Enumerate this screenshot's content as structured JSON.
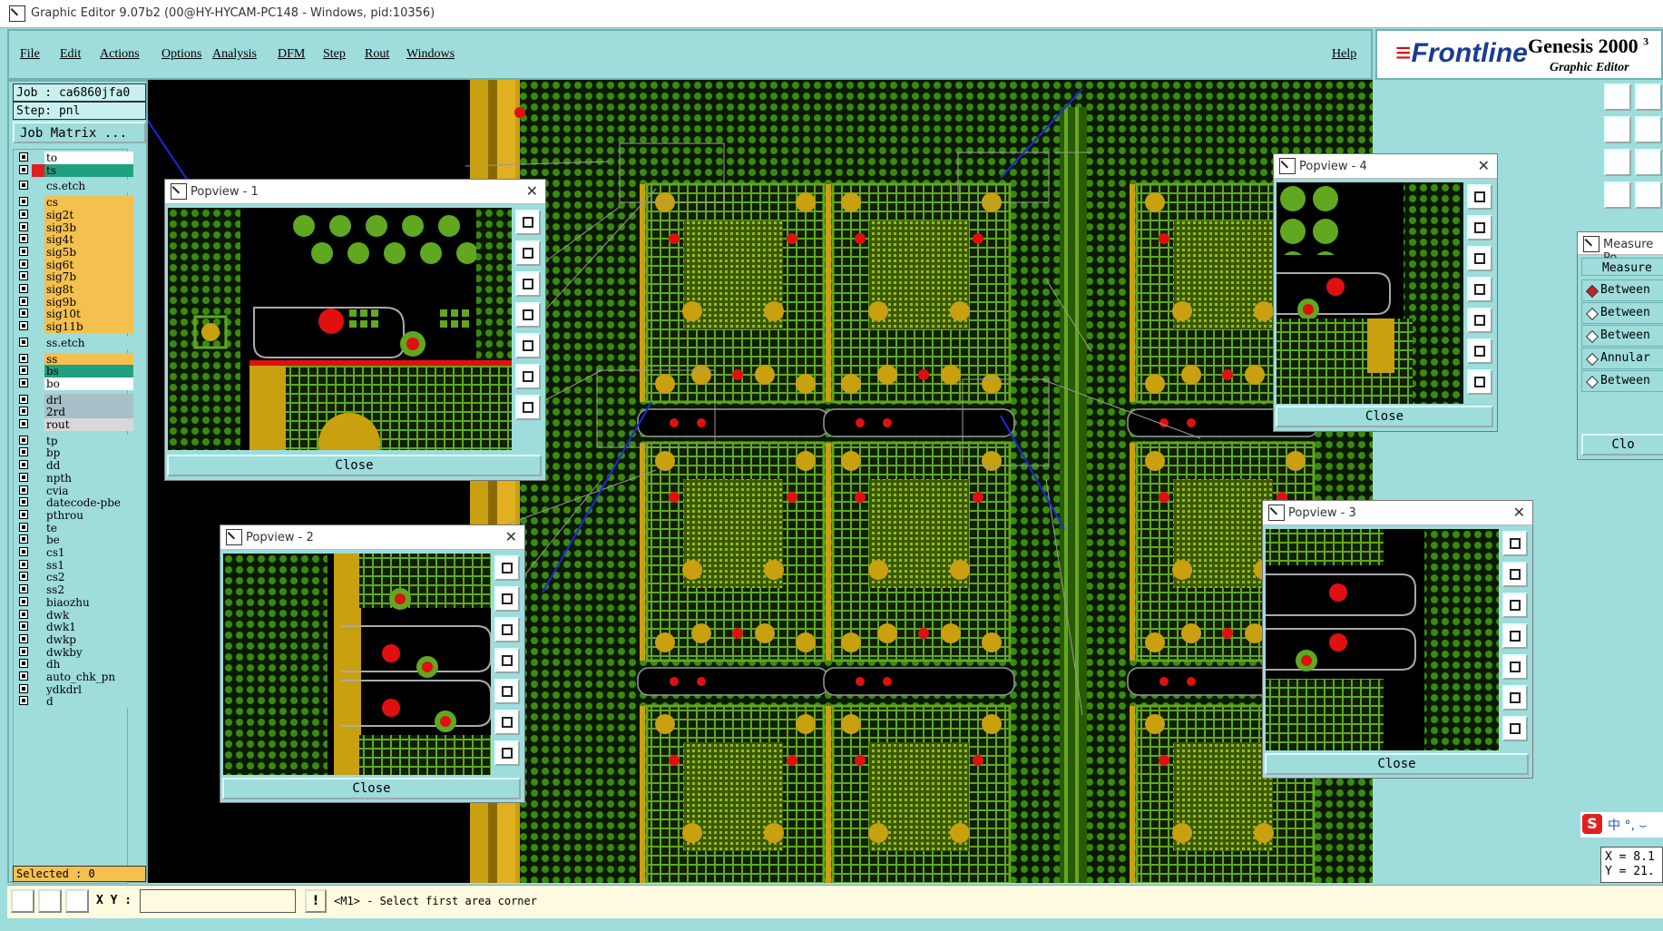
{
  "window": {
    "title": "Graphic Editor 9.07b2 (00@HY-HYCAM-PC148 - Windows, pid:10356)"
  },
  "menu": [
    "File",
    "Edit",
    "Actions",
    "Options",
    "Analysis",
    "DFM",
    "Step",
    "Rout",
    "Windows"
  ],
  "help": "Help",
  "brand": {
    "logo": "Frontline",
    "product": "Genesis 2000",
    "superscript": "3",
    "subtitle": "Graphic Editor"
  },
  "job": {
    "job_label": "Job : ca6860jfa0",
    "step_label": "Step: pnl",
    "matrix_button": "Job Matrix ..."
  },
  "layers": [
    {
      "name": "to",
      "color": "#ffffff",
      "swatch": "#9fdcdc"
    },
    {
      "name": "ts",
      "color": "#20a080",
      "swatch": "#e02020",
      "active": true
    },
    {
      "name": "cs.etch",
      "color": "#9fdcdc",
      "swatch": "#9fdcdc"
    },
    {
      "name": "cs",
      "color": "#f4c050",
      "swatch": "#9fdcdc"
    },
    {
      "name": "sig2t",
      "color": "#f4c050",
      "swatch": "#9fdcdc"
    },
    {
      "name": "sig3b",
      "color": "#f4c050",
      "swatch": "#9fdcdc"
    },
    {
      "name": "sig4t",
      "color": "#f4c050",
      "swatch": "#9fdcdc"
    },
    {
      "name": "sig5b",
      "color": "#f4c050",
      "swatch": "#9fdcdc"
    },
    {
      "name": "sig6t",
      "color": "#f4c050",
      "swatch": "#9fdcdc"
    },
    {
      "name": "sig7b",
      "color": "#f4c050",
      "swatch": "#9fdcdc"
    },
    {
      "name": "sig8t",
      "color": "#f4c050",
      "swatch": "#9fdcdc"
    },
    {
      "name": "sig9b",
      "color": "#f4c050",
      "swatch": "#9fdcdc"
    },
    {
      "name": "sig10t",
      "color": "#f4c050",
      "swatch": "#9fdcdc"
    },
    {
      "name": "sig11b",
      "color": "#f4c050",
      "swatch": "#9fdcdc"
    },
    {
      "name": "ss.etch",
      "color": "#9fdcdc",
      "swatch": "#9fdcdc"
    },
    {
      "name": "ss",
      "color": "#f4c050",
      "swatch": "#9fdcdc"
    },
    {
      "name": "bs",
      "color": "#20a080",
      "swatch": "#9fdcdc"
    },
    {
      "name": "bo",
      "color": "#ffffff",
      "swatch": "#9fdcdc"
    },
    {
      "name": "drl",
      "color": "#a8c0c8",
      "swatch": "#9fdcdc"
    },
    {
      "name": "2rd",
      "color": "#a8c0c8",
      "swatch": "#9fdcdc"
    },
    {
      "name": "rout",
      "color": "#d8d8d8",
      "swatch": "#9fdcdc"
    },
    {
      "name": "tp",
      "color": "#9fdcdc",
      "swatch": "#9fdcdc"
    },
    {
      "name": "bp",
      "color": "#9fdcdc",
      "swatch": "#9fdcdc"
    },
    {
      "name": "dd",
      "color": "#9fdcdc",
      "swatch": "#9fdcdc"
    },
    {
      "name": "npth",
      "color": "#9fdcdc",
      "swatch": "#9fdcdc"
    },
    {
      "name": "cvia",
      "color": "#9fdcdc",
      "swatch": "#9fdcdc"
    },
    {
      "name": "datecode-pbe",
      "color": "#9fdcdc",
      "swatch": "#9fdcdc"
    },
    {
      "name": "pthrou",
      "color": "#9fdcdc",
      "swatch": "#9fdcdc"
    },
    {
      "name": "te",
      "color": "#9fdcdc",
      "swatch": "#9fdcdc"
    },
    {
      "name": "be",
      "color": "#9fdcdc",
      "swatch": "#9fdcdc"
    },
    {
      "name": "cs1",
      "color": "#9fdcdc",
      "swatch": "#9fdcdc"
    },
    {
      "name": "ss1",
      "color": "#9fdcdc",
      "swatch": "#9fdcdc"
    },
    {
      "name": "cs2",
      "color": "#9fdcdc",
      "swatch": "#9fdcdc"
    },
    {
      "name": "ss2",
      "color": "#9fdcdc",
      "swatch": "#9fdcdc"
    },
    {
      "name": "biaozhu",
      "color": "#9fdcdc",
      "swatch": "#9fdcdc"
    },
    {
      "name": "dwk",
      "color": "#9fdcdc",
      "swatch": "#9fdcdc"
    },
    {
      "name": "dwk1",
      "color": "#9fdcdc",
      "swatch": "#9fdcdc"
    },
    {
      "name": "dwkp",
      "color": "#9fdcdc",
      "swatch": "#9fdcdc"
    },
    {
      "name": "dwkby",
      "color": "#9fdcdc",
      "swatch": "#9fdcdc"
    },
    {
      "name": "dh",
      "color": "#9fdcdc",
      "swatch": "#9fdcdc"
    },
    {
      "name": "auto_chk_pn",
      "color": "#9fdcdc",
      "swatch": "#9fdcdc"
    },
    {
      "name": "ydkdrl",
      "color": "#9fdcdc",
      "swatch": "#9fdcdc"
    },
    {
      "name": "d",
      "color": "#9fdcdc",
      "swatch": "#9fdcdc"
    }
  ],
  "selected": "Selected : 0",
  "popviews": [
    {
      "title": "Popview - 1",
      "close": "Close"
    },
    {
      "title": "Popview - 2",
      "close": "Close"
    },
    {
      "title": "Popview - 3",
      "close": "Close"
    },
    {
      "title": "Popview - 4",
      "close": "Close"
    }
  ],
  "measure": {
    "title": "Measure Po",
    "header": "Measure",
    "options": [
      {
        "label": "Between",
        "selected": true
      },
      {
        "label": "Between",
        "selected": false
      },
      {
        "label": "Between",
        "selected": false
      },
      {
        "label": "Annular",
        "selected": false
      },
      {
        "label": "Between",
        "selected": false
      }
    ],
    "close": "Clo"
  },
  "status": {
    "xy_label": "X Y :",
    "xy_value": "",
    "warn": "!",
    "prompt": "<M1> - Select first area corner"
  },
  "coords": {
    "x": "X = 8.1",
    "y": "Y = 21."
  },
  "ime": {
    "badge": "S",
    "text": "中 °, ⌣"
  },
  "colors": {
    "panel": "#9fdcdc",
    "copper": "#60a820",
    "pad": "#c8a010",
    "flash": "#e01010",
    "background": "#000000"
  }
}
